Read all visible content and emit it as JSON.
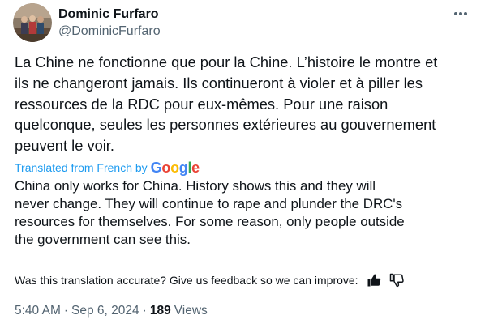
{
  "author": {
    "name": "Dominic Furfaro",
    "handle": "@DominicFurfaro",
    "avatar_icon": "profile-photo"
  },
  "more_icon": "more-options-icon",
  "tweet": {
    "original_text": "La Chine ne fonctionne que pour la Chine. L’histoire le montre et\nils ne changeront jamais. Ils continueront à violer et à piller les\nressources de la RDC pour eux-mêmes. Pour une raison\nquelconque, seules les personnes extérieures au gouvernement\npeuvent le voir.",
    "translated_label": "Translated from French by",
    "translator_logo": "Google",
    "translated_text": "China only works for China. History shows this and they will\nnever change. They will continue to rape and plunder the DRC's\nresources for themselves. For some reason, only people outside\nthe government can see this."
  },
  "feedback": {
    "question": "Was this translation accurate? Give us feedback so we can improve:",
    "thumbs_up_icon": "thumbs-up-icon",
    "thumbs_down_icon": "thumbs-down-icon"
  },
  "meta": {
    "time": "5:40 AM",
    "separator": "·",
    "date": "Sep 6, 2024",
    "views_count": "189",
    "views_label": "Views"
  },
  "colors": {
    "text": "#0f1419",
    "secondary": "#536471",
    "link_blue": "#1d9bf0",
    "google_blue": "#4285F4",
    "google_red": "#EA4335",
    "google_yellow": "#FBBC05",
    "google_green": "#34A853"
  }
}
